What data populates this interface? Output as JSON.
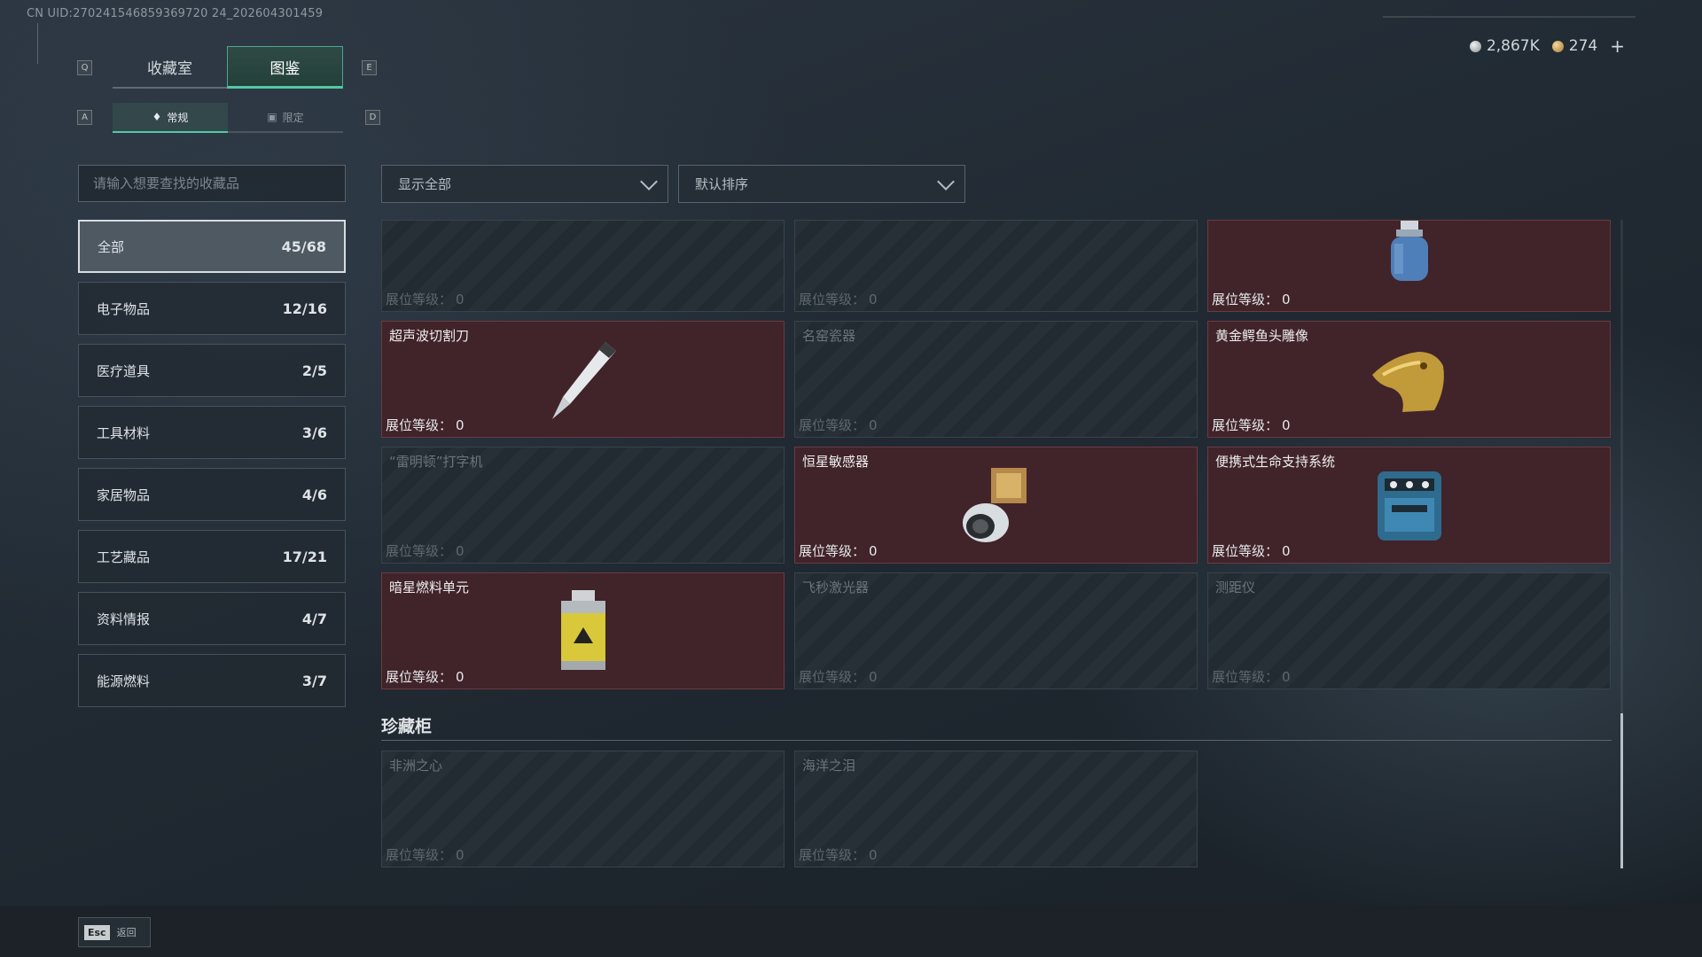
{
  "uid": "CN UID:270241546859369720 24_202604301459",
  "currency": {
    "silver": "2,867K",
    "gold": "274",
    "plus": "+"
  },
  "keys": {
    "q": "Q",
    "e": "E",
    "a": "A",
    "d": "D"
  },
  "tabs": [
    {
      "label": "收藏室"
    },
    {
      "label": "图鉴"
    }
  ],
  "subtabs": [
    {
      "label": "常规"
    },
    {
      "label": "限定"
    }
  ],
  "search": {
    "placeholder": "请输入想要查找的收藏品"
  },
  "categories": [
    {
      "label": "全部",
      "count": "45/68"
    },
    {
      "label": "电子物品",
      "count": "12/16"
    },
    {
      "label": "医疗道具",
      "count": "2/5"
    },
    {
      "label": "工具材料",
      "count": "3/6"
    },
    {
      "label": "家居物品",
      "count": "4/6"
    },
    {
      "label": "工艺藏品",
      "count": "17/21"
    },
    {
      "label": "资料情报",
      "count": "4/7"
    },
    {
      "label": "能源燃料",
      "count": "3/7"
    }
  ],
  "filters": {
    "show": "显示全部",
    "sort": "默认排序"
  },
  "level_label": "展位等级：",
  "items": [
    {
      "name": "",
      "level": "0",
      "owned": false
    },
    {
      "name": "",
      "level": "0",
      "owned": false
    },
    {
      "name": "",
      "level": "0",
      "owned": true,
      "icon": "gas-canister-icon"
    },
    {
      "name": "超声波切割刀",
      "level": "0",
      "owned": true,
      "icon": "ultrasonic-knife-icon"
    },
    {
      "name": "名窑瓷器",
      "level": "0",
      "owned": false
    },
    {
      "name": "黄金鳄鱼头雕像",
      "level": "0",
      "owned": true,
      "icon": "gold-crocodile-icon"
    },
    {
      "name": "“雷明顿”打字机",
      "level": "0",
      "owned": false
    },
    {
      "name": "恒星敏感器",
      "level": "0",
      "owned": true,
      "icon": "star-sensor-icon"
    },
    {
      "name": "便携式生命支持系统",
      "level": "0",
      "owned": true,
      "icon": "life-support-icon"
    },
    {
      "name": "暗星燃料单元",
      "level": "0",
      "owned": true,
      "icon": "fuel-cell-icon"
    },
    {
      "name": "飞秒激光器",
      "level": "0",
      "owned": false
    },
    {
      "name": "测距仪",
      "level": "0",
      "owned": false
    }
  ],
  "cabinet": {
    "title": "珍藏柜",
    "items": [
      {
        "name": "非洲之心",
        "level": "0",
        "owned": false
      },
      {
        "name": "海洋之泪",
        "level": "0",
        "owned": false
      }
    ]
  },
  "footer": {
    "esc_key": "Esc",
    "esc_label": "返回"
  }
}
